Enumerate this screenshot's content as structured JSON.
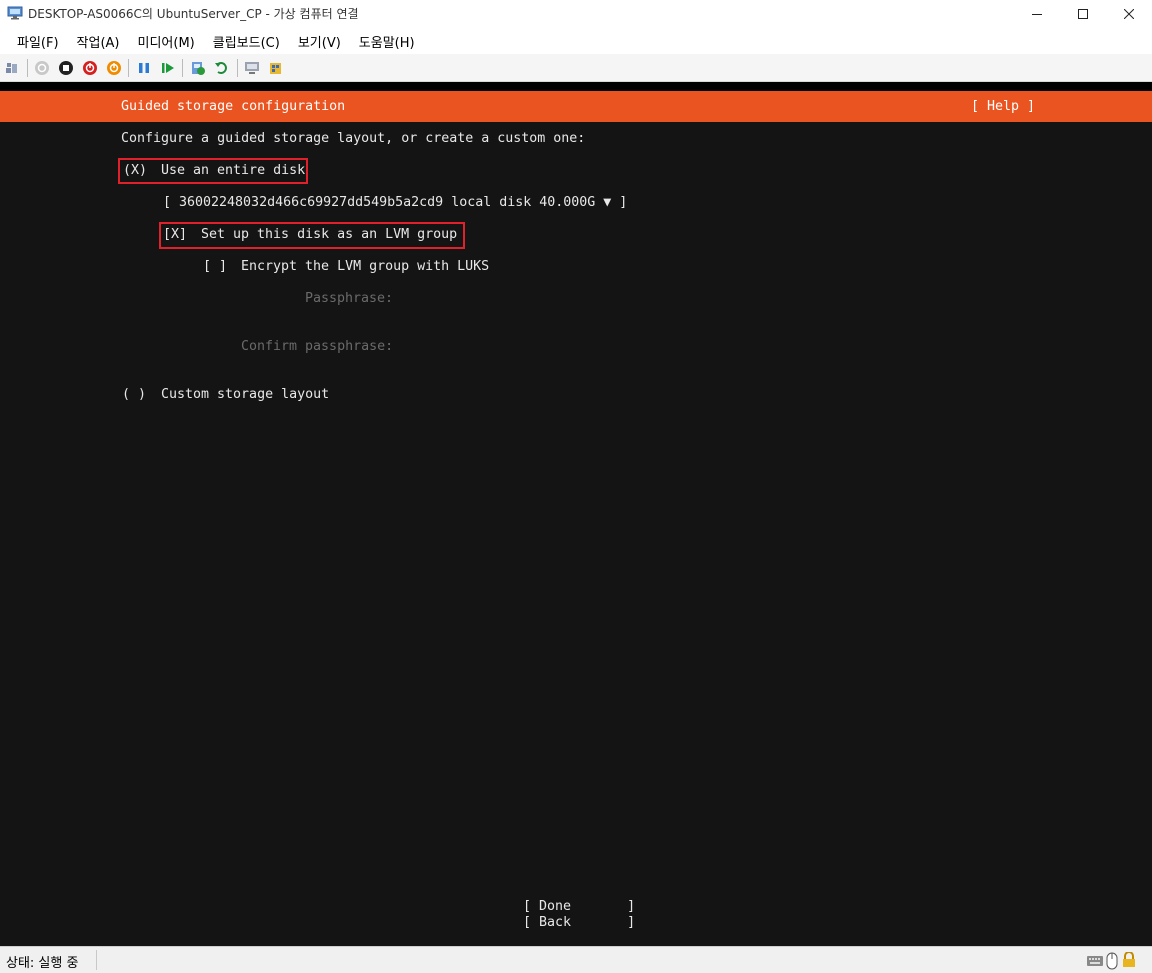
{
  "window": {
    "title": "DESKTOP-AS0066C의 UbuntuServer_CP - 가상 컴퓨터 연결",
    "minimize": "—",
    "maximize": "☐",
    "close": "✕"
  },
  "menu": {
    "items": [
      "파일(F)",
      "작업(A)",
      "미디어(M)",
      "클립보드(C)",
      "보기(V)",
      "도움말(H)"
    ]
  },
  "toolbar": {
    "icons": [
      "ctrl-alt-del-icon",
      "start-icon",
      "turn-off-icon",
      "shutdown-icon",
      "save-state-icon",
      "pause-icon",
      "resume-icon",
      "checkpoint-icon",
      "revert-icon",
      "enhanced-session-icon",
      "share-icon"
    ]
  },
  "installer": {
    "header_title": "Guided storage configuration",
    "header_help": "[ Help ]",
    "intro": "Configure a guided storage layout, or create a custom one:",
    "entire_disk_radio": "(X)",
    "entire_disk_label": "Use an entire disk",
    "disk_select": "[ 36002248032d466c69927dd549b5a2cd9 local disk 40.000G ▼ ]",
    "lvm_checkbox": "[X]",
    "lvm_label": "Set up this disk as an LVM group",
    "encrypt_checkbox": "[ ]",
    "encrypt_label": "Encrypt the LVM group with LUKS",
    "passphrase_label": "Passphrase:",
    "confirm_passphrase_label": "Confirm passphrase:",
    "custom_radio": "( )",
    "custom_label": "Custom storage layout",
    "done_button": "[ Done       ]",
    "back_button": "[ Back       ]"
  },
  "status": {
    "text": "상태: 실행 중"
  },
  "colors": {
    "accent": "#e95420",
    "highlight_box": "#e0202a",
    "terminal_bg": "#141414"
  }
}
